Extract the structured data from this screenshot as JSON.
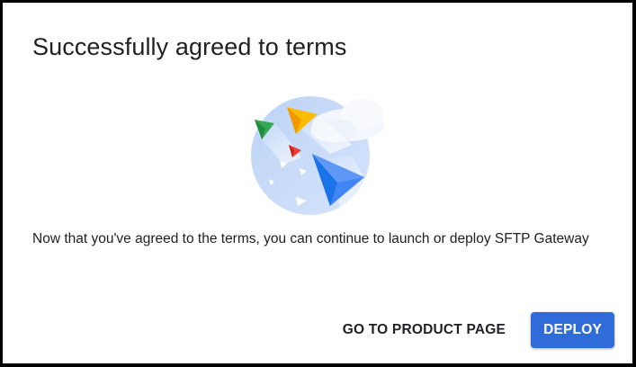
{
  "dialog": {
    "title": "Successfully agreed to terms",
    "illustration_icon": "paper-planes-illustration",
    "message": "Now that you've agreed to the terms, you can continue to launch or deploy SFTP Gateway",
    "actions": {
      "secondary_label": "GO TO PRODUCT PAGE",
      "primary_label": "DEPLOY"
    }
  },
  "colors": {
    "primary": "#2f6bd9",
    "text": "#202124",
    "plane_green": "#34a853",
    "plane_yellow": "#fbbc04",
    "plane_red": "#ea4335",
    "plane_blue": "#4285f4",
    "circle": "#c9dcf8"
  }
}
